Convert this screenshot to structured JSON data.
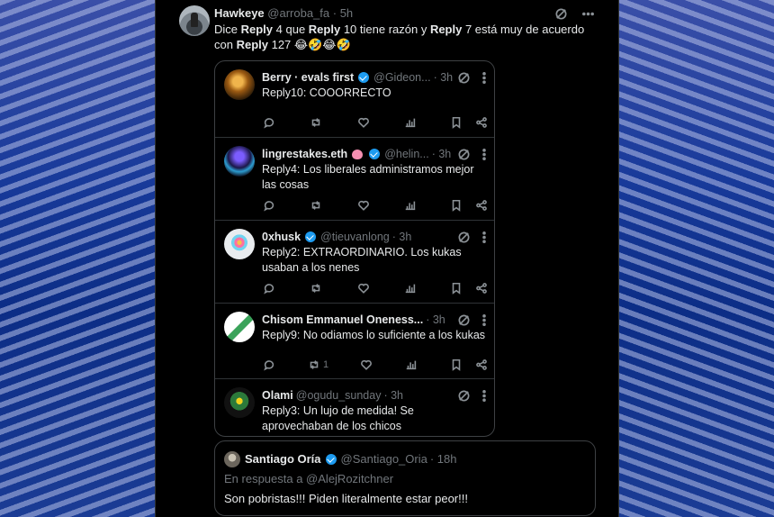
{
  "main_tweet": {
    "name": "Hawkeye",
    "handle": "@arroba_fa",
    "time": "· 5h",
    "text_parts": [
      "Dice ",
      "Reply",
      " 4 que ",
      "Reply",
      " 10 tiene razón y ",
      "Reply",
      " 7 está muy de acuerdo con ",
      "Reply",
      " 127 😂🤣😂🤣"
    ]
  },
  "replies": [
    {
      "name": "Berry · evals first",
      "verified": true,
      "handle": "@Gideon...",
      "time": "· 3h",
      "text": "Reply10: COOORRECTO",
      "retweets": ""
    },
    {
      "name": "lingrestakes.eth",
      "verified": true,
      "brain": true,
      "handle": "@helin...",
      "time": "· 3h",
      "text": "Reply4: Los liberales administramos mejor las cosas",
      "retweets": ""
    },
    {
      "name": "0xhusk",
      "verified": true,
      "handle": "@tieuvanlong",
      "time": "· 3h",
      "text": "Reply2: EXTRAORDINARIO. Los kukas usaban a los nenes",
      "retweets": ""
    },
    {
      "name": "Chisom Emmanuel Oneness...",
      "verified": false,
      "handle": "",
      "time": "· 3h",
      "text": "Reply9: No odiamos lo suficiente a los kukas",
      "retweets": "1"
    },
    {
      "name": "Olami",
      "verified": false,
      "handle": "@ogudu_sunday",
      "time": "· 3h",
      "text": "Reply3: Un lujo de medida! Se aprovechaban de los chicos",
      "retweets": ""
    }
  ],
  "quoted": {
    "name": "Santiago Oría",
    "handle": "@Santiago_Oria",
    "time": "· 18h",
    "reply_to": "En respuesta a @AlejRozitchner",
    "text": "Son pobristas!!! Piden literalmente estar peor!!!"
  },
  "colors": {
    "accent": "#1d9bf0",
    "background": "#000000",
    "muted": "#71767b"
  }
}
